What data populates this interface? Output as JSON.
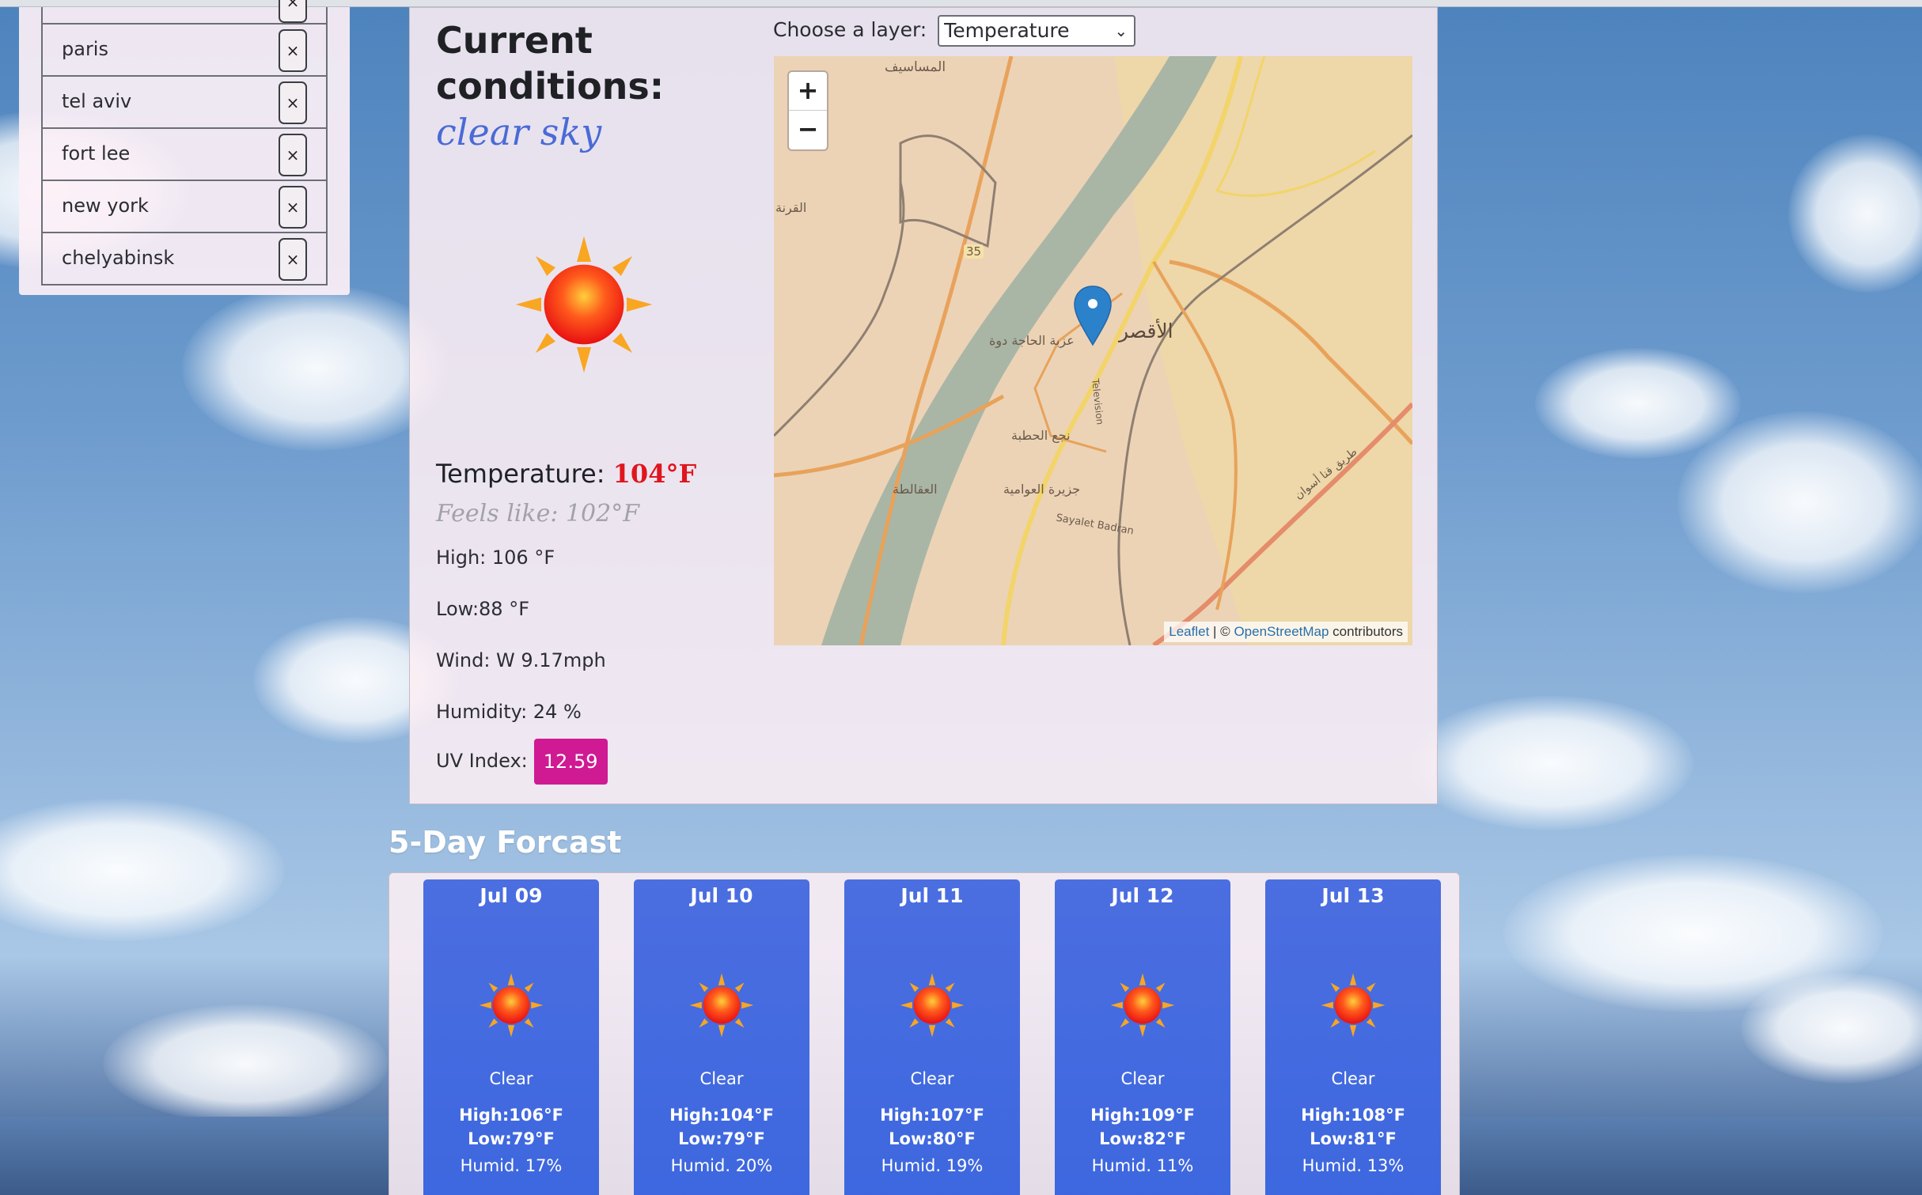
{
  "cities": {
    "items": [
      {
        "name": "paris"
      },
      {
        "name": "tel aviv"
      },
      {
        "name": "fort lee"
      },
      {
        "name": "new york"
      },
      {
        "name": "chelyabinsk"
      }
    ],
    "remove_label": "×"
  },
  "current": {
    "title_prefix": "Current conditions:",
    "description": "clear sky",
    "temperature_label": "Temperature:",
    "temperature_value": "104°F",
    "feels_like": "Feels like: 102°F",
    "high": "High: 106 °F",
    "low": "Low:88 °F",
    "wind": "Wind: W 9.17mph",
    "humidity": "Humidity: 24 %",
    "uv_label": "UV Index:",
    "uv_value": "12.59",
    "uv_color": "#cf1a93",
    "icon": "sun-icon"
  },
  "map": {
    "layer_label": "Choose a layer:",
    "layer_selected": "Temperature",
    "zoom_in": "+",
    "zoom_out": "−",
    "attribution_leaflet": "Leaflet",
    "attribution_sep": " | © ",
    "attribution_osm": "OpenStreetMap",
    "attribution_suffix": " contributors",
    "labels": {
      "l1": "المساسيف",
      "l2": "القرنة",
      "l3": "35",
      "l4": "عزبة الحاجة دوة",
      "l5": "الأقصر",
      "l6": "نجع الحطبة",
      "l7": "العقالطة",
      "l8": "جزيرة العوامية",
      "l9": "Sayalet Badran",
      "l10": "Television",
      "l11": "طريق قنا أسوان"
    }
  },
  "forecast": {
    "title": "5-Day Forcast",
    "days": [
      {
        "date": "Jul 09",
        "cond": "Clear",
        "high": "High:106°F",
        "low": "Low:79°F",
        "humid": "Humid. 17%"
      },
      {
        "date": "Jul 10",
        "cond": "Clear",
        "high": "High:104°F",
        "low": "Low:79°F",
        "humid": "Humid. 20%"
      },
      {
        "date": "Jul 11",
        "cond": "Clear",
        "high": "High:107°F",
        "low": "Low:80°F",
        "humid": "Humid. 19%"
      },
      {
        "date": "Jul 12",
        "cond": "Clear",
        "high": "High:109°F",
        "low": "Low:82°F",
        "humid": "Humid. 11%"
      },
      {
        "date": "Jul 13",
        "cond": "Clear",
        "high": "High:108°F",
        "low": "Low:81°F",
        "humid": "Humid. 13%"
      }
    ]
  }
}
